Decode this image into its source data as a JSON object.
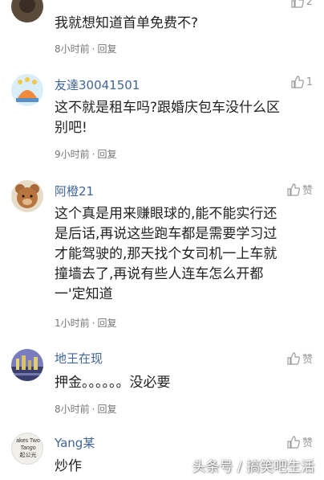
{
  "comments": [
    {
      "username": "",
      "content": [
        "我就想知道首单免费不?"
      ],
      "time": "8小时前",
      "reply": "回复",
      "likes": "2"
    },
    {
      "username": "友達30041501",
      "content": [
        "这不就是租车吗?跟婚庆包车没什么区",
        "别吧!"
      ],
      "time": "9小时前",
      "reply": "回复",
      "likes": "1"
    },
    {
      "username": "阿橙21",
      "content": [
        "这个真是用来赚眼球的,能不能实行还",
        "是后话,再说这些跑车都是需要学习过",
        "才能驾驶的,那天找个女司机一上车就",
        "撞墙去了,再说有些人连车怎么开都",
        "一'定知道"
      ],
      "time": "1小时前",
      "reply": "回复",
      "likes": "赞"
    },
    {
      "username": "地王在现",
      "content": [
        "押金。。。。。。没必要"
      ],
      "time": "8小时前",
      "reply": "回复",
      "likes": "赞"
    },
    {
      "username": "Yang某",
      "content": [
        "炒作"
      ],
      "time": "",
      "reply": "",
      "likes": "赞"
    }
  ],
  "avatar5_text": [
    "akes Two",
    "Tango",
    "起公光"
  ],
  "watermark": "头条号 / 搞笑吧生活"
}
